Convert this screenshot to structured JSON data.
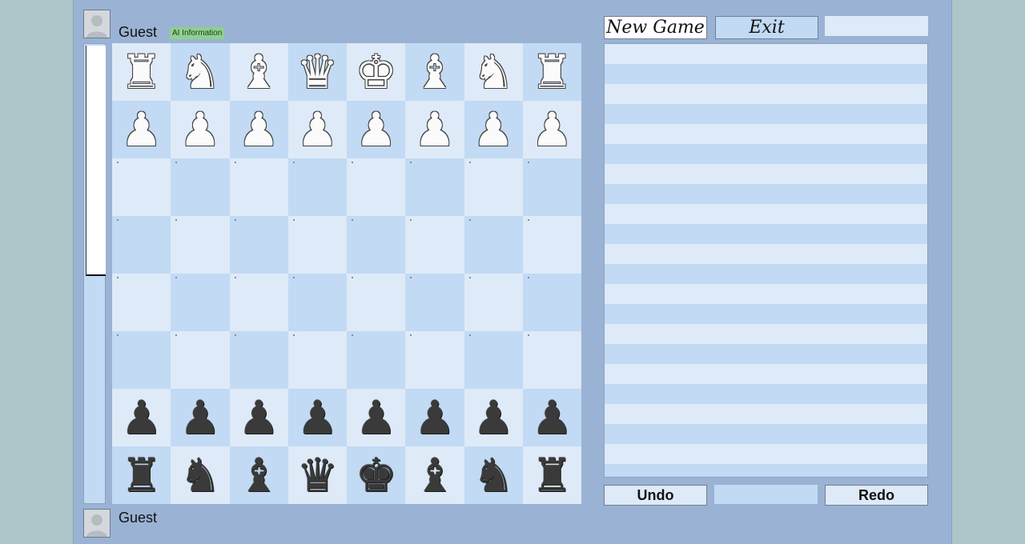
{
  "top_player": {
    "name": "Guest",
    "ai_info_label": "AI Information"
  },
  "bottom_player": {
    "name": "Guest"
  },
  "controls": {
    "new_game_label": "New Game",
    "exit_label": "Exit",
    "undo_label": "Undo",
    "redo_label": "Redo"
  },
  "board": {
    "rows": [
      [
        "white-rook",
        "white-knight",
        "white-bishop",
        "white-queen",
        "white-king",
        "white-bishop",
        "white-knight",
        "white-rook"
      ],
      [
        "white-pawn",
        "white-pawn",
        "white-pawn",
        "white-pawn",
        "white-pawn",
        "white-pawn",
        "white-pawn",
        "white-pawn"
      ],
      [
        "",
        "",
        "",
        "",
        "",
        "",
        "",
        ""
      ],
      [
        "",
        "",
        "",
        "",
        "",
        "",
        "",
        ""
      ],
      [
        "",
        "",
        "",
        "",
        "",
        "",
        "",
        ""
      ],
      [
        "",
        "",
        "",
        "",
        "",
        "",
        "",
        ""
      ],
      [
        "black-pawn",
        "black-pawn",
        "black-pawn",
        "black-pawn",
        "black-pawn",
        "black-pawn",
        "black-pawn",
        "black-pawn"
      ],
      [
        "black-rook",
        "black-knight",
        "black-bishop",
        "black-queen",
        "black-king",
        "black-bishop",
        "black-knight",
        "black-rook"
      ]
    ]
  },
  "evaluation": {
    "white_share": 0.5
  },
  "move_list": {
    "entries": []
  },
  "colors": {
    "light_square": "#deeaf8",
    "dark_square": "#c2daf3",
    "panel_bg": "#9ab3d4"
  }
}
